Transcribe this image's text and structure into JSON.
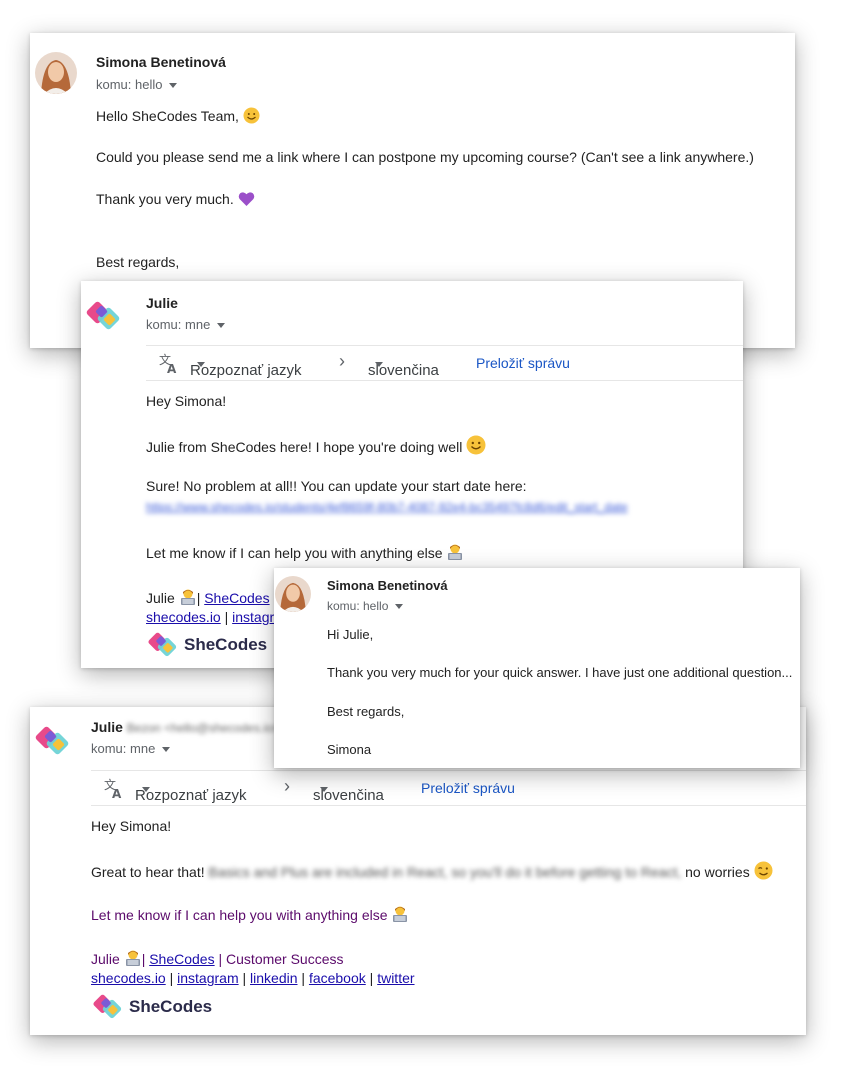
{
  "email1": {
    "sender": "Simona Benetinová",
    "komu": "komu: hello",
    "lines": [
      "Hello SheCodes Team,",
      "Could you please send me a link where I can postpone my upcoming course? (Can't see a link anywhere.)",
      "Thank you very much.",
      "Best regards,"
    ]
  },
  "email2": {
    "sender": "Julie",
    "komu": "komu: mne",
    "translate": {
      "detect": "Rozpoznať jazyk",
      "target": "slovenčina",
      "action": "Preložiť správu"
    },
    "greeting": "Hey Simona!",
    "intro": "Julie from SheCodes here! I hope you're doing well",
    "sure": "Sure! No problem at all!! You can update your start date here:",
    "url": "https://www.shecodes.io/students/4ef8659f-80b7-4087-92e4-bc35497fc8d6/edit_start_date",
    "help": "Let me know if I can help you with anything else",
    "sig_name": "Julie",
    "sig_brand": "SheCodes",
    "sig_site": "shecodes.io",
    "sig_instagram": "instagram",
    "logo_text": "SheCodes"
  },
  "email3": {
    "sender": "Simona Benetinová",
    "komu": "komu: hello",
    "lines": [
      "Hi Julie,",
      "Thank you very much for your quick answer. I have just one additional question...",
      "Best regards,",
      "Simona"
    ]
  },
  "email4": {
    "sender": "Julie",
    "sender_blurred": "Bezon <hello@shecodes.io>",
    "komu": "komu: mne",
    "translate": {
      "detect": "Rozpoznať jazyk",
      "target": "slovenčina",
      "action": "Preložiť správu"
    },
    "greeting": "Hey Simona!",
    "great_prefix": "Great to hear that!",
    "great_blurred": "Basics and Plus are included in React, so you'll do it before getting to React,",
    "great_suffix": "no worries",
    "help": "Let me know if I can help you with anything else",
    "sig_name": "Julie",
    "sig_brand": "SheCodes",
    "sig_role": "| Customer Success",
    "links": [
      "shecodes.io",
      "instagram",
      "linkedin",
      "facebook",
      "twitter"
    ],
    "logo_text": "SheCodes"
  },
  "colors": {
    "link": "#1a0dab",
    "translate_action": "#1a56c5",
    "purple_text": "#5b0a6b",
    "muted": "#5f6368"
  },
  "icons": [
    "avatar-photo",
    "shecodes-logo",
    "translate-icon",
    "chevron-right-icon",
    "smile-emoji",
    "heart-emoji",
    "technologist-emoji",
    "wink-emoji"
  ]
}
